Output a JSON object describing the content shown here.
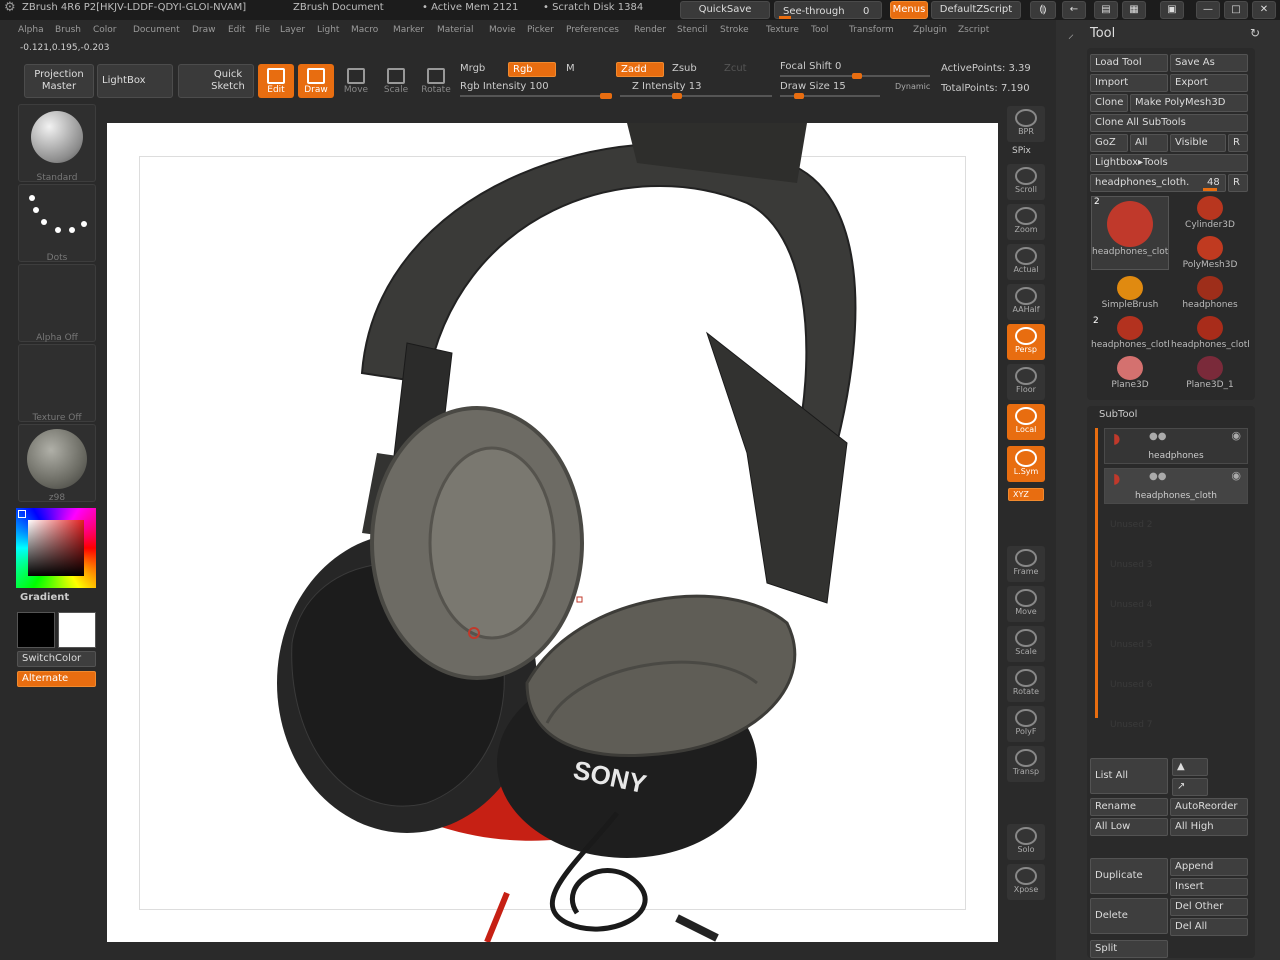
{
  "titlebar": {
    "app": "ZBrush 4R6 P2[HKJV-LDDF-QDYI-GLOI-NVAM]",
    "document": "ZBrush Document",
    "active_mem": "• Active Mem 2121",
    "scratch_disk": "• Scratch Disk 1384",
    "quicksave": "QuickSave",
    "see_through": "See-through",
    "see_through_value": "0",
    "menus": "Menus",
    "script": "DefaultZScript"
  },
  "menubar": {
    "items": [
      "Alpha",
      "Brush",
      "Color",
      "Document",
      "Draw",
      "Edit",
      "File",
      "Layer",
      "Light",
      "Macro",
      "Marker",
      "Material",
      "Movie",
      "Picker",
      "Preferences",
      "Render",
      "Stencil",
      "Stroke",
      "Texture",
      "Tool",
      "Transform",
      "Zplugin",
      "Zscript"
    ]
  },
  "coords": "-0.121,0.195,-0.203",
  "shelf": {
    "projection_master": "Projection Master",
    "lightbox": "LightBox",
    "quick_sketch": "Quick Sketch",
    "tools": [
      {
        "label": "Edit",
        "active": true
      },
      {
        "label": "Draw",
        "active": true
      },
      {
        "label": "Move",
        "active": false
      },
      {
        "label": "Scale",
        "active": false
      },
      {
        "label": "Rotate",
        "active": false
      }
    ],
    "mrgb": "Mrgb",
    "rgb": "Rgb",
    "m": "M",
    "rgb_intensity": "Rgb Intensity 100",
    "zadd": "Zadd",
    "zsub": "Zsub",
    "zcut": "Zcut",
    "z_intensity": "Z Intensity 13",
    "focal_shift": "Focal Shift 0",
    "draw_size": "Draw Size 15",
    "dynamic": "Dynamic",
    "active_points": "ActivePoints: 3.39",
    "total_points": "TotalPoints: 7.190"
  },
  "left": {
    "brush_caption": "Standard",
    "stroke_caption": "Dots",
    "alpha_caption": "Alpha Off",
    "texture_caption": "Texture Off",
    "material_caption": "z98",
    "gradient": "Gradient",
    "switch_color": "SwitchColor",
    "alternate": "Alternate"
  },
  "right_toolbar": [
    {
      "label": "BPR",
      "active": false
    },
    {
      "label": "Scroll",
      "active": false
    },
    {
      "label": "Zoom",
      "active": false
    },
    {
      "label": "Actual",
      "active": false
    },
    {
      "label": "AAHalf",
      "active": false
    },
    {
      "label": "Persp",
      "active": true
    },
    {
      "label": "Floor",
      "active": false
    },
    {
      "label": "Local",
      "active": true
    },
    {
      "label": "L.Sym",
      "active": true
    },
    {
      "label": "Frame",
      "active": false
    },
    {
      "label": "Move",
      "active": false
    },
    {
      "label": "Scale",
      "active": false
    },
    {
      "label": "Rotate",
      "active": false
    },
    {
      "label": "PolyF",
      "active": false
    },
    {
      "label": "Transp",
      "active": false
    },
    {
      "label": "Solo",
      "active": false
    },
    {
      "label": "Xpose",
      "active": false
    }
  ],
  "spix": "SPix",
  "xyz": "XYZ",
  "tool_panel": {
    "title": "Tool",
    "load_tool": "Load Tool",
    "save_as": "Save As",
    "import": "Import",
    "export": "Export",
    "clone": "Clone",
    "make_polymesh": "Make PolyMesh3D",
    "clone_all": "Clone All SubTools",
    "goz": "GoZ",
    "all": "All",
    "visible": "Visible",
    "r": "R",
    "lightbox_tools": "Lightbox▸Tools",
    "current_tool": "headphones_cloth.",
    "current_tool_num": "48",
    "items": [
      {
        "label": "headphones_cloth",
        "badge": "2",
        "color": "#c0392b"
      },
      {
        "label": "Cylinder3D",
        "badge": "",
        "color": "#b8361f"
      },
      {
        "label": "PolyMesh3D",
        "badge": "",
        "color": "#c03a20"
      },
      {
        "label": "SimpleBrush",
        "badge": "",
        "color": "#e08a10"
      },
      {
        "label": "headphones",
        "badge": "",
        "color": "#9e2e1a"
      },
      {
        "label": "headphones_cloth",
        "badge": "2",
        "color": "#b3321f"
      },
      {
        "label": "headphones_cloth",
        "badge": "",
        "color": "#a82c1a"
      },
      {
        "label": "Plane3D",
        "badge": "",
        "color": "#d4716f"
      },
      {
        "label": "Plane3D_1",
        "badge": "",
        "color": "#7a2a3a"
      }
    ]
  },
  "subtool": {
    "title": "SubTool",
    "rows": [
      "headphones",
      "headphones_cloth"
    ],
    "empty": [
      "Unused 2",
      "Unused 3",
      "Unused 4",
      "Unused 5",
      "Unused 6",
      "Unused 7"
    ],
    "list_all": "List All",
    "rename": "Rename",
    "auto_reorder": "AutoReorder",
    "all_low": "All Low",
    "all_high": "All High",
    "duplicate": "Duplicate",
    "append": "Append",
    "insert": "Insert",
    "delete": "Delete",
    "del_other": "Del Other",
    "del_all": "Del All",
    "split": "Split"
  },
  "canvas": {
    "brand_text": "SONY"
  },
  "colors": {
    "accent": "#e86d10",
    "background": "#2a2a2a",
    "canvas": "#ffffff"
  }
}
